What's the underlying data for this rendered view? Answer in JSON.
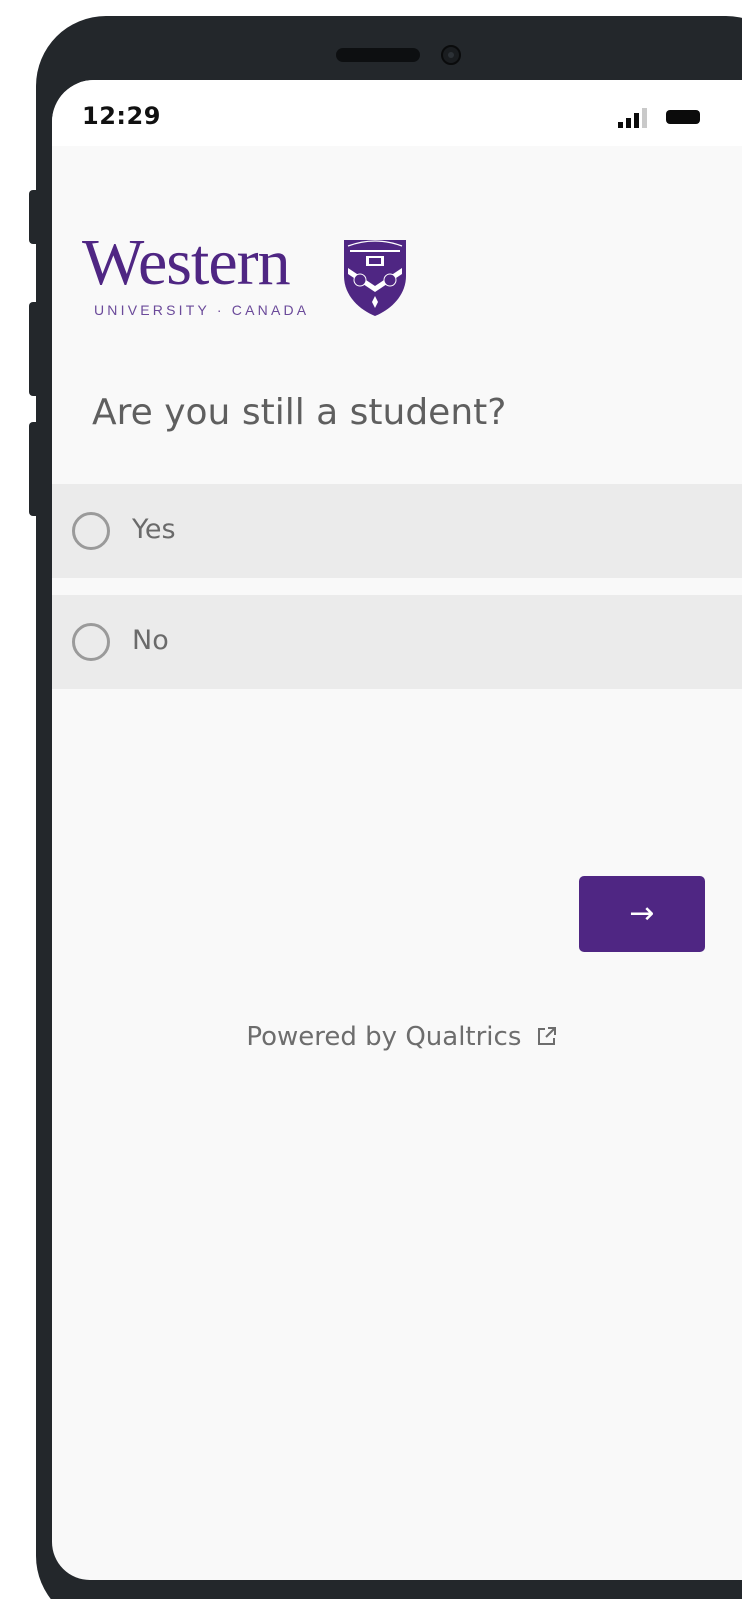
{
  "status_bar": {
    "time": "12:29",
    "signal_icon": "cellular-signal-icon",
    "battery_icon": "battery-icon"
  },
  "logo": {
    "word": "Western",
    "subtitle": "UNIVERSITY · CANADA",
    "crest_icon": "university-crest-icon",
    "brand_color": "#4f2683"
  },
  "survey": {
    "question": "Are you still a student?",
    "choices": [
      {
        "label": "Yes",
        "selected": false
      },
      {
        "label": "No",
        "selected": false
      }
    ],
    "next_label": "→",
    "next_color": "#4f2683"
  },
  "footer": {
    "powered_by": "Powered by Qualtrics",
    "external_icon": "external-link-icon"
  }
}
